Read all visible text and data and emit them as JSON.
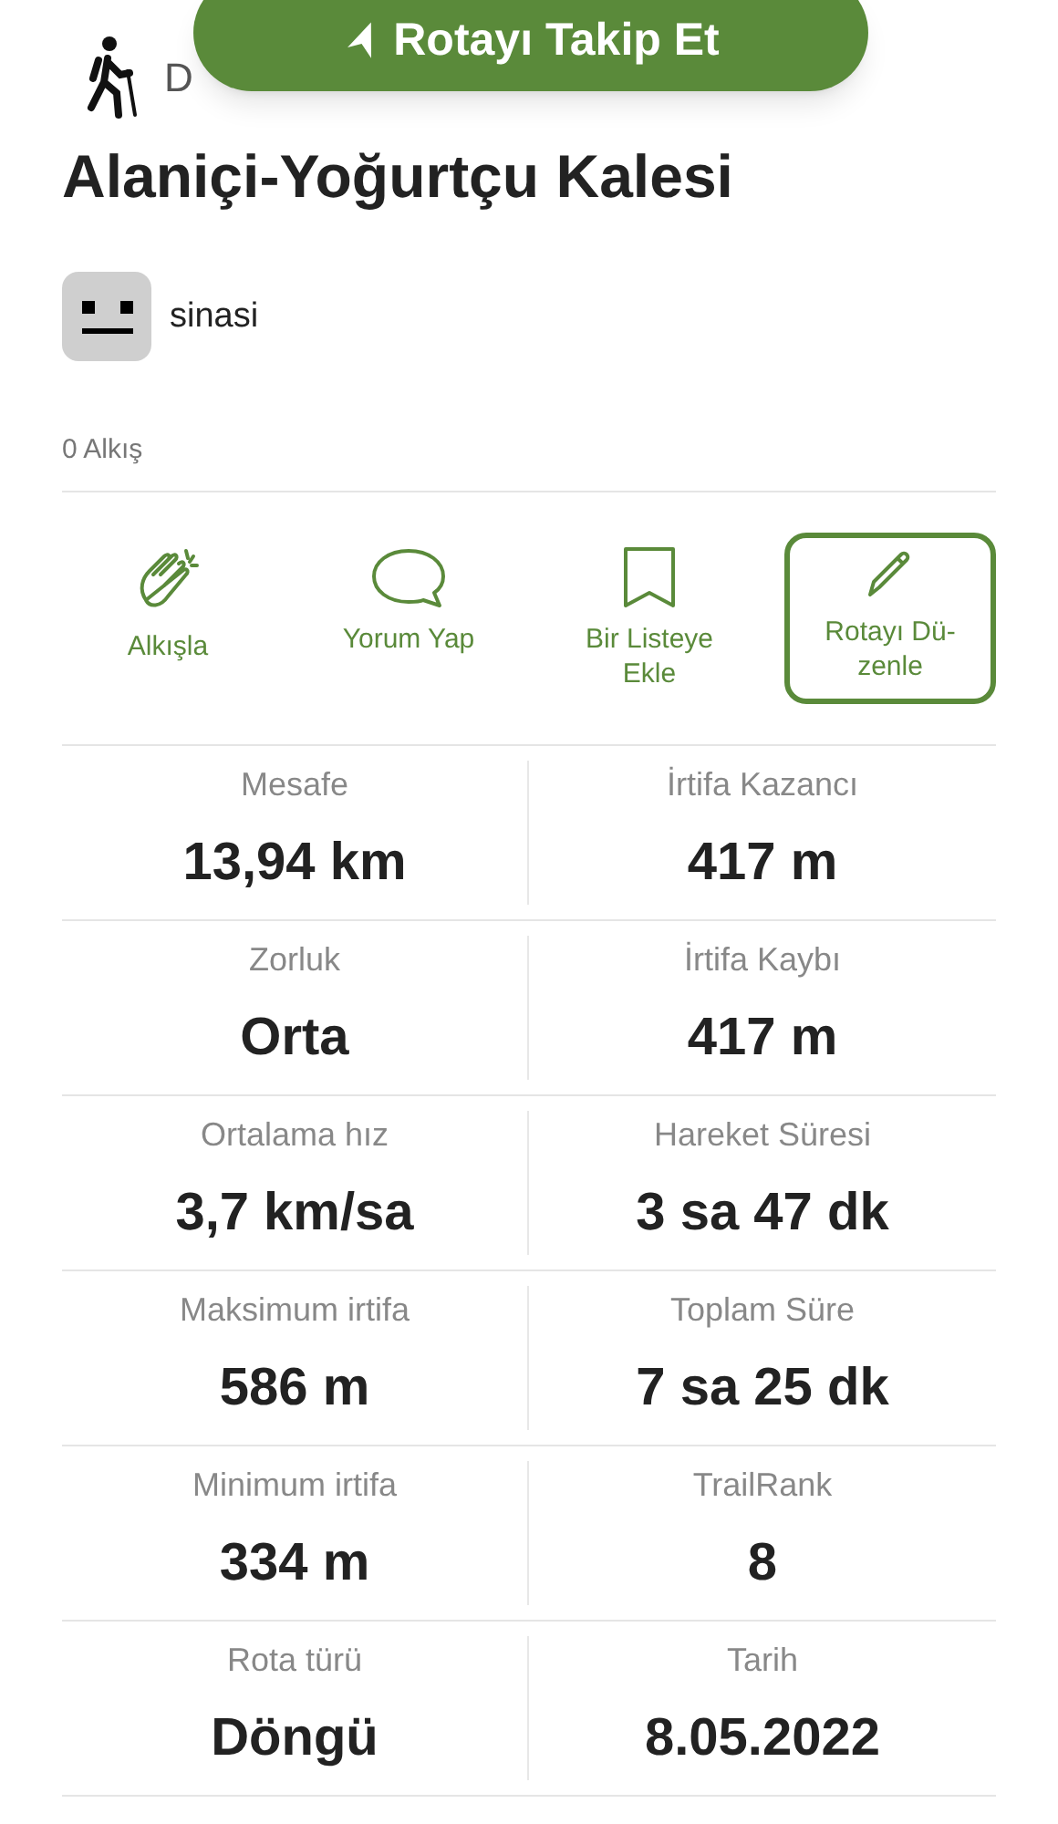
{
  "follow_button": {
    "label": "Rotayı Takip Et"
  },
  "activity_label": "D",
  "title": "Alaniçi-Yoğurtçu Kalesi",
  "author": {
    "name": "sinasi"
  },
  "claps": "0 Alkış",
  "actions": [
    {
      "kind": "clap",
      "label": "Alkışla",
      "selected": false
    },
    {
      "kind": "comment",
      "label": "Yorum Yap",
      "selected": false
    },
    {
      "kind": "bookmark",
      "label": "Bir Listeye Ekle",
      "selected": false
    },
    {
      "kind": "edit",
      "label": "Rotayı Dü-zenle",
      "selected": true
    }
  ],
  "stats": [
    {
      "label": "Mesafe",
      "value": "13,94 km"
    },
    {
      "label": "İrtifa Kazancı",
      "value": "417 m"
    },
    {
      "label": "Zorluk",
      "value": "Orta"
    },
    {
      "label": "İrtifa Kaybı",
      "value": "417 m"
    },
    {
      "label": "Ortalama hız",
      "value": "3,7 km/sa"
    },
    {
      "label": "Hareket Süresi",
      "value": "3 sa 47 dk"
    },
    {
      "label": "Maksimum irtifa",
      "value": "586 m"
    },
    {
      "label": "Toplam Süre",
      "value": "7 sa 25 dk"
    },
    {
      "label": "Minimum irtifa",
      "value": "334 m"
    },
    {
      "label": "TrailRank",
      "value": "8"
    },
    {
      "label": "Rota türü",
      "value": "Döngü"
    },
    {
      "label": "Tarih",
      "value": "8.05.2022"
    }
  ]
}
